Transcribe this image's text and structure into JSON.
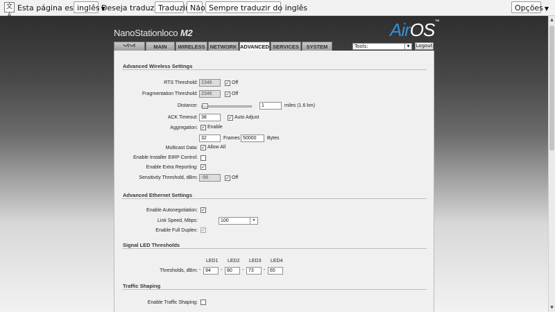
{
  "translate_bar": {
    "prompt": "Esta página está em",
    "language": "inglês",
    "question": "Deseja traduzi-la?",
    "translate": "Traduzir",
    "no": "Não",
    "always": "Sempre traduzir do inglês",
    "options": "Opções"
  },
  "header": {
    "brand": "NanoStation",
    "brand_model": "loco",
    "brand_suffix": "M2",
    "logo_a": "Air",
    "logo_b": "OS",
    "logo_tm": "™"
  },
  "tabs": [
    "MAIN",
    "WIRELESS",
    "NETWORK",
    "ADVANCED",
    "SERVICES",
    "SYSTEM"
  ],
  "active_tab": "ADVANCED",
  "tools": {
    "selected": "Tools:",
    "logout": "Logout"
  },
  "wireless": {
    "title": "Advanced Wireless Settings",
    "rts_label": "RTS Threshold:",
    "rts_value": "2346",
    "rts_off": "Off",
    "frag_label": "Fragmentation Threshold:",
    "frag_value": "2346",
    "frag_off": "Off",
    "distance_label": "Distance:",
    "distance_value": "1",
    "distance_units": "miles (1.6 km)",
    "ack_label": "ACK Timeout:",
    "ack_value": "38",
    "ack_auto": "Auto Adjust",
    "aggregation_label": "Aggregation:",
    "aggregation_enable": "Enable",
    "frames_value": "32",
    "frames_label": "Frames",
    "bytes_value": "50000",
    "bytes_label": "Bytes",
    "multicast_label": "Multicast Data:",
    "multicast_allow": "Allow All",
    "installer_label": "Enable Installer EIRP Control:",
    "extra_label": "Enable Extra Reporting:",
    "sensitivity_label": "Sensitivity Threshold, dBm:",
    "sensitivity_value": "-96",
    "sensitivity_off": "Off"
  },
  "ethernet": {
    "title": "Advanced Ethernet Settings",
    "autoneg_label": "Enable Autonegotiation:",
    "speed_label": "Link Speed, Mbps:",
    "speed_value": "100",
    "duplex_label": "Enable Full Duplex:"
  },
  "led": {
    "title": "Signal LED Thresholds",
    "headers": [
      "LED1",
      "LED2",
      "LED3",
      "LED4"
    ],
    "label": "Thresholds, dBm:",
    "dash": "-",
    "values": [
      "94",
      "80",
      "73",
      "65"
    ]
  },
  "shaping": {
    "title": "Traffic Shaping",
    "enable_label": "Enable Traffic Shaping:"
  },
  "checkmark": "✓"
}
